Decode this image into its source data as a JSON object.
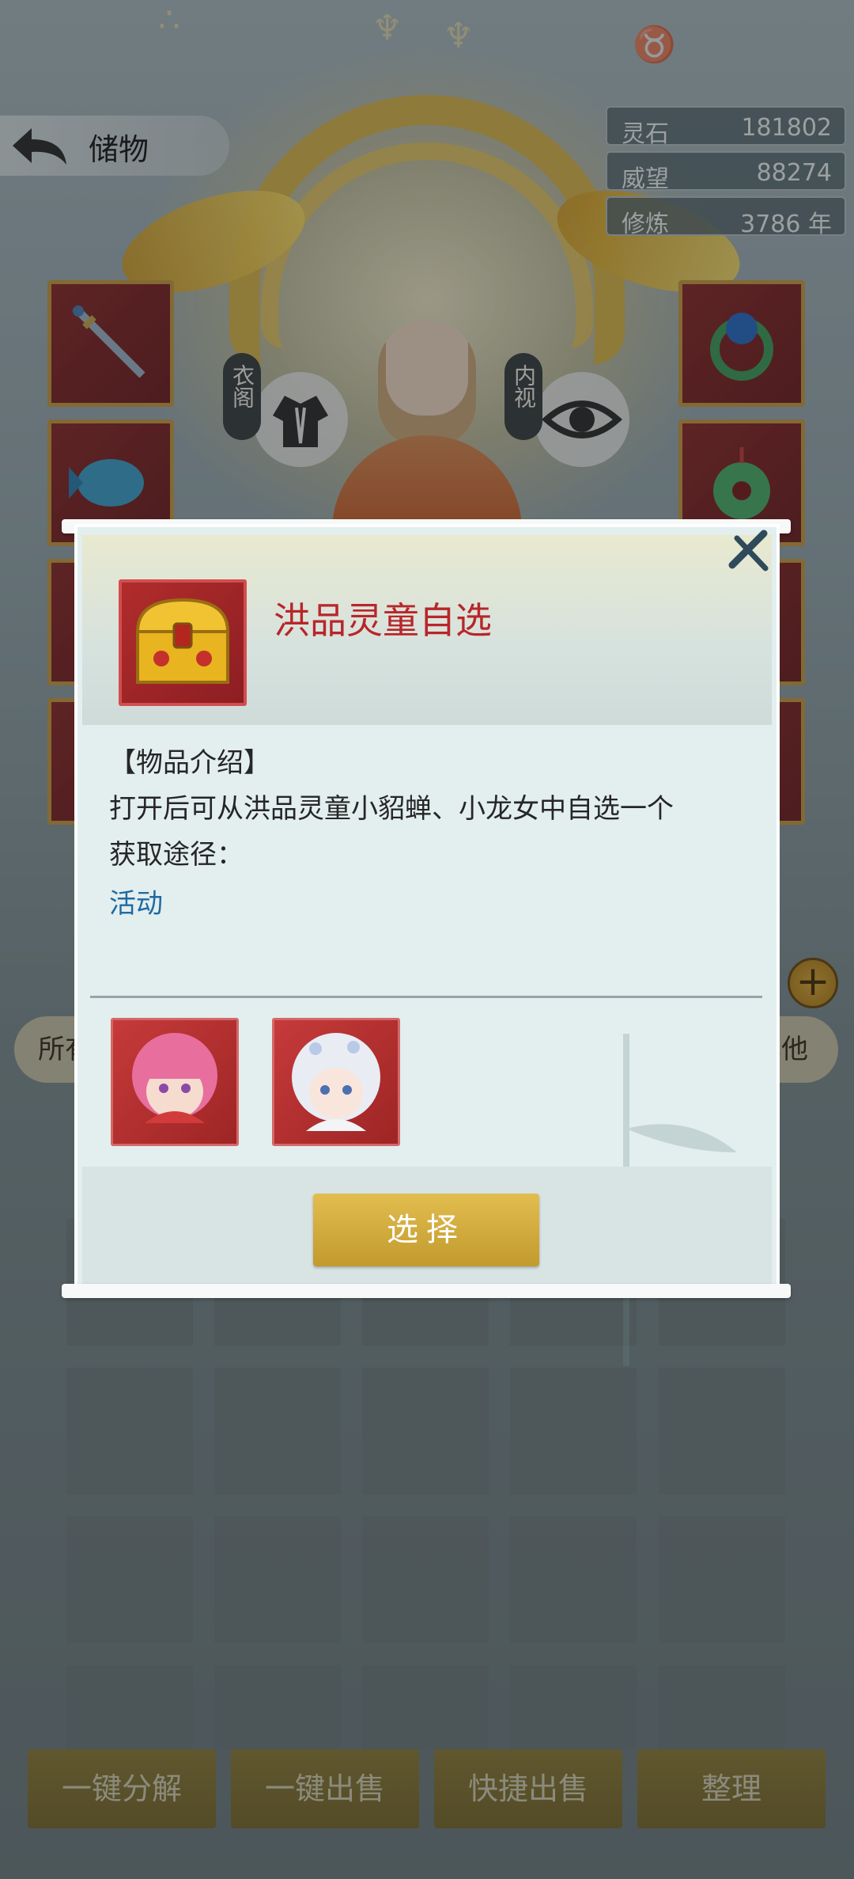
{
  "header": {
    "back_icon": "back-arrow-icon",
    "title": "储物"
  },
  "stats": [
    {
      "label": "灵石",
      "value": "181802"
    },
    {
      "label": "威望",
      "value": "88274"
    },
    {
      "label": "修炼",
      "value": "3786 年"
    }
  ],
  "character": {
    "wardrobe_tag": "衣阁",
    "inner_view_tag": "内视"
  },
  "equipment_slots": {
    "left": [
      "sword-icon",
      "blue-fish-icon",
      "item-icon",
      "item-icon"
    ],
    "right": [
      "ring-icon",
      "jade-pendant-icon",
      "item-icon",
      "item-icon"
    ]
  },
  "filters": {
    "first_partial": "所有",
    "last_partial": "其他"
  },
  "bottom_bar": {
    "buttons": [
      "一键分解",
      "一键出售",
      "快捷出售",
      "整理"
    ]
  },
  "modal": {
    "item_name": "洪品灵童自选",
    "item_icon": "treasure-chest-icon",
    "desc_title": "【物品介绍】",
    "desc_text": "打开后可从洪品灵童小貂蝉、小龙女中自选一个",
    "source_label": "获取途径：",
    "source_value": "活动",
    "choices": [
      "pink-hair-girl-portrait",
      "white-hair-girl-portrait"
    ],
    "select_label": "选择",
    "colors": {
      "item_name": "#b8262b",
      "source_link": "#1f6aa0",
      "select_button": "#c8a23a"
    }
  }
}
